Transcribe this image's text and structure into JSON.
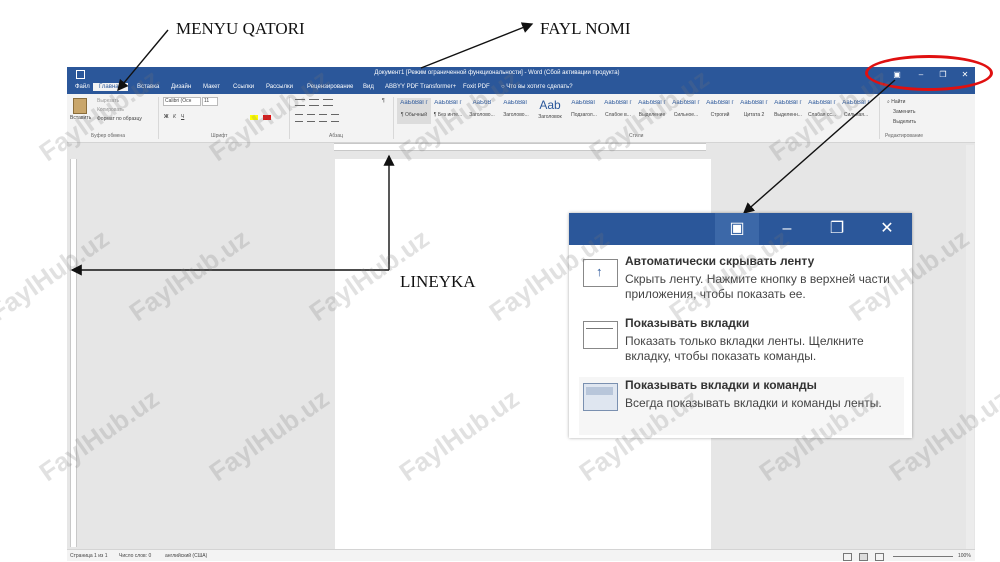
{
  "annotations": {
    "menu_row": "MENYU QATORI",
    "file_name": "FAYL NOMI",
    "ruler": "LINEYKA"
  },
  "word": {
    "title": "Документ1 [Режим ограниченной функциональности] - Word (Сбой активации продукта)",
    "tabs": [
      "Файл",
      "Главная",
      "Вставка",
      "Дизайн",
      "Макет",
      "Ссылки",
      "Рассылки",
      "Рецензирование",
      "Вид",
      "ABBYY PDF Transformer+",
      "Foxit PDF"
    ],
    "tell_me": "Что вы хотите сделать?",
    "clipboard": {
      "paste": "Вставить",
      "cut": "Вырезать",
      "copy": "Копировать",
      "format_painter": "Формат по образцу",
      "label": "Буфер обмена"
    },
    "font": {
      "name": "Calibri (Осн",
      "size": "11",
      "label": "Шрифт"
    },
    "paragraph_label": "Абзац",
    "styles": {
      "label": "Стили",
      "items": [
        {
          "preview": "АаБбВвГг",
          "name": "¶ Обычный"
        },
        {
          "preview": "АаБбВвГг",
          "name": "¶ Без инте..."
        },
        {
          "preview": "АаБбВ",
          "name": "Заголово..."
        },
        {
          "preview": "АаБбВвГ",
          "name": "Заголово..."
        },
        {
          "preview": "Aab",
          "name": "Заголовок"
        },
        {
          "preview": "АаБбВвГ",
          "name": "Подзагол..."
        },
        {
          "preview": "АаБбВвГг",
          "name": "Слабое в..."
        },
        {
          "preview": "АаБбВвГг",
          "name": "Выделение"
        },
        {
          "preview": "АаБбВвГг",
          "name": "Сильное..."
        },
        {
          "preview": "АаБбВвГг",
          "name": "Строгий"
        },
        {
          "preview": "АаБбВвГг",
          "name": "Цитата 2"
        },
        {
          "preview": "АаБбВвГг",
          "name": "Выделенн..."
        },
        {
          "preview": "АаБбВвГг",
          "name": "Слабая сс..."
        },
        {
          "preview": "АаБбВвГг",
          "name": "Сильная..."
        }
      ]
    },
    "editing": {
      "find": "Найти",
      "replace": "Заменить",
      "select": "Выделить",
      "label": "Редактирование"
    },
    "status": {
      "page": "Страница 1 из 1",
      "words": "Число слов: 0",
      "language": "английский (США)",
      "zoom": "100%"
    }
  },
  "ribbon_options_popup": {
    "options": [
      {
        "title": "Автоматически скрывать ленту",
        "desc": "Скрыть ленту. Нажмите кнопку в верхней части приложения, чтобы показать ее."
      },
      {
        "title": "Показывать вкладки",
        "desc": "Показать только вкладки ленты. Щелкните вкладку, чтобы показать команды."
      },
      {
        "title": "Показывать вкладки и команды",
        "desc": "Всегда показывать вкладки и команды ленты."
      }
    ]
  },
  "watermark": "FaylHub.uz",
  "colors": {
    "word_blue": "#2b579a",
    "highlight_red": "#e01010"
  }
}
